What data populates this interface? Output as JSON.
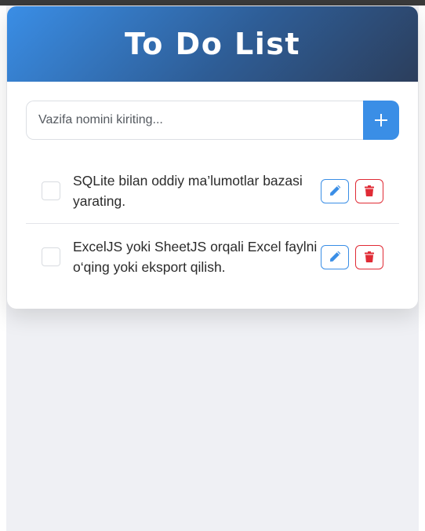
{
  "header": {
    "title": "To Do List"
  },
  "new_task": {
    "placeholder": "Vazifa nomini kiriting...",
    "value": "",
    "add_icon": "plus-icon"
  },
  "tasks": [
    {
      "text": "SQLite bilan oddiy ma’lumotlar bazasi yarating.",
      "completed": false,
      "edit_icon": "pencil-icon",
      "delete_icon": "trash-icon"
    },
    {
      "text": "ExcelJS yoki SheetJS orqali Excel faylni o‘qing yoki eksport qilish.",
      "completed": false,
      "edit_icon": "pencil-icon",
      "delete_icon": "trash-icon"
    }
  ],
  "colors": {
    "accent": "#3a8ee6",
    "header_gradient_end": "#2c3e5c",
    "danger": "#e02b35",
    "page_background": "#eff0f4"
  }
}
